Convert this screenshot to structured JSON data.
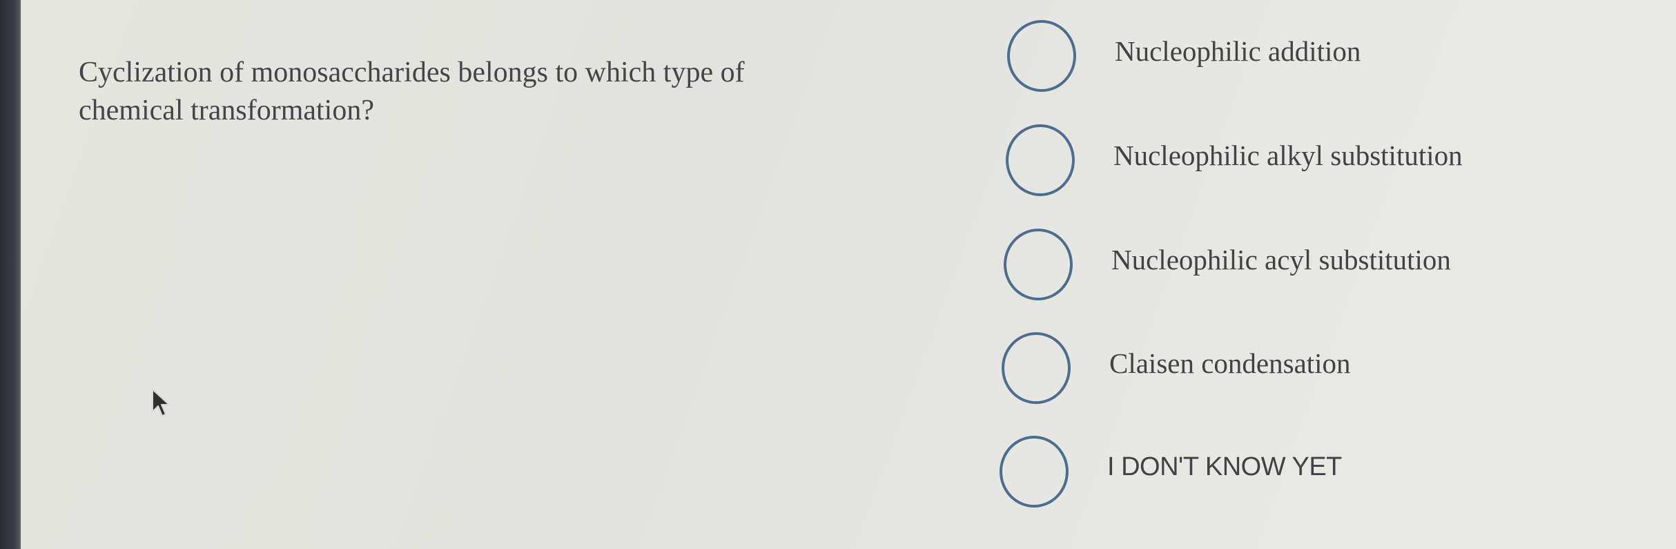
{
  "question": {
    "text": "Cyclization of monosaccharides belongs to which type of chemical transformation?"
  },
  "options": [
    {
      "label": "Nucleophilic addition",
      "selected": false
    },
    {
      "label": "Nucleophilic alkyl substitution",
      "selected": false
    },
    {
      "label": "Nucleophilic acyl substitution",
      "selected": false
    },
    {
      "label": "Claisen condensation",
      "selected": false
    },
    {
      "label": "I DON'T KNOW YET",
      "selected": false
    }
  ],
  "colors": {
    "radio_border": "#4d6d8f",
    "text": "#404246",
    "background": "#e4e4e0"
  },
  "icons": {
    "cursor": "mouse-pointer-icon"
  }
}
